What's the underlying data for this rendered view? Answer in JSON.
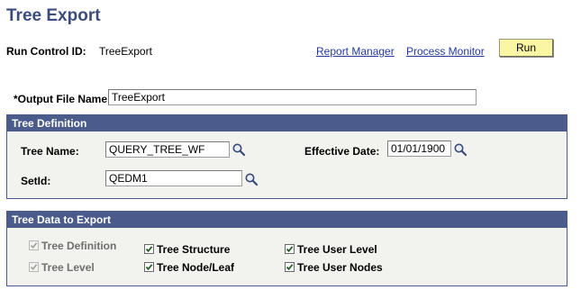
{
  "page": {
    "title": "Tree Export"
  },
  "run_control": {
    "label": "Run Control ID:",
    "value": "TreeExport"
  },
  "links": {
    "report_manager": "Report Manager",
    "process_monitor": "Process Monitor"
  },
  "run_button": {
    "label": "Run"
  },
  "output_file": {
    "label": "*Output File Name:",
    "value": "TreeExport"
  },
  "tree_definition": {
    "header": "Tree Definition",
    "tree_name": {
      "label": "Tree Name:",
      "value": "QUERY_TREE_WF"
    },
    "effective_date": {
      "label": "Effective Date:",
      "value": "01/01/1900"
    },
    "setid": {
      "label": "SetId:",
      "value": "QEDM1"
    }
  },
  "tree_data": {
    "header": "Tree Data to Export",
    "options": [
      {
        "label": "Tree Definition",
        "checked": true,
        "disabled": true
      },
      {
        "label": "Tree Level",
        "checked": true,
        "disabled": true
      },
      {
        "label": "Tree Structure",
        "checked": true,
        "disabled": false
      },
      {
        "label": "Tree Node/Leaf",
        "checked": true,
        "disabled": false
      },
      {
        "label": "Tree User Level",
        "checked": true,
        "disabled": false
      },
      {
        "label": "Tree User Nodes",
        "checked": true,
        "disabled": false
      }
    ]
  },
  "colors": {
    "header_bg": "#4a5b8c",
    "title": "#3c4c7c",
    "link": "#25399c",
    "button_bg": "#fbf6a4",
    "group_bg": "#f2f2ee"
  }
}
